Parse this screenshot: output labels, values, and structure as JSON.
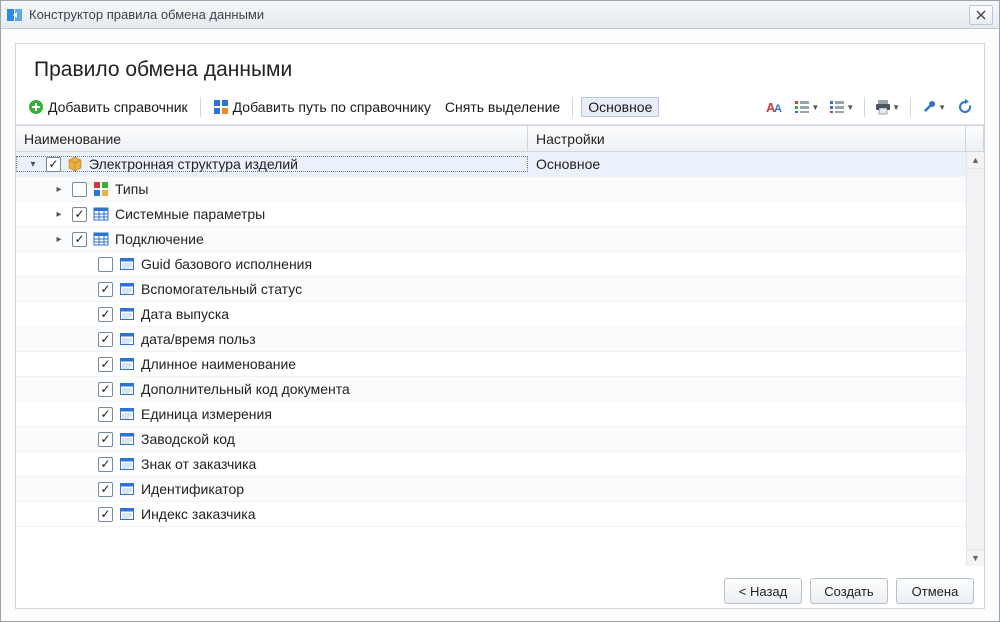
{
  "window": {
    "title": "Конструктор правила обмена данными"
  },
  "heading": "Правило обмена данными",
  "toolbar": {
    "add_reference": "Добавить справочник",
    "add_path": "Добавить путь по справочнику",
    "deselect": "Снять выделение",
    "main_toggle": "Основное"
  },
  "columns": {
    "name": "Наименование",
    "settings": "Настройки"
  },
  "tree": [
    {
      "indent": 0,
      "expander": "down",
      "checked": true,
      "icon": "package",
      "label": "Электронная структура изделий",
      "settings": "Основное",
      "selected": true,
      "focus": true
    },
    {
      "indent": 1,
      "expander": "right",
      "checked": false,
      "icon": "types",
      "label": "Типы"
    },
    {
      "indent": 1,
      "expander": "right",
      "checked": true,
      "icon": "table",
      "label": "Системные параметры"
    },
    {
      "indent": 1,
      "expander": "right",
      "checked": true,
      "icon": "table",
      "label": "Подключение"
    },
    {
      "indent": 2,
      "expander": "",
      "checked": false,
      "icon": "field",
      "label": "Guid базового исполнения"
    },
    {
      "indent": 2,
      "expander": "",
      "checked": true,
      "icon": "field",
      "label": "Вспомогательный статус"
    },
    {
      "indent": 2,
      "expander": "",
      "checked": true,
      "icon": "field",
      "label": "Дата выпуска"
    },
    {
      "indent": 2,
      "expander": "",
      "checked": true,
      "icon": "field",
      "label": "дата/время польз"
    },
    {
      "indent": 2,
      "expander": "",
      "checked": true,
      "icon": "field",
      "label": "Длинное наименование"
    },
    {
      "indent": 2,
      "expander": "",
      "checked": true,
      "icon": "field",
      "label": "Дополнительный код документа"
    },
    {
      "indent": 2,
      "expander": "",
      "checked": true,
      "icon": "field",
      "label": "Единица измерения"
    },
    {
      "indent": 2,
      "expander": "",
      "checked": true,
      "icon": "field",
      "label": "Заводской код"
    },
    {
      "indent": 2,
      "expander": "",
      "checked": true,
      "icon": "field",
      "label": "Знак от заказчика"
    },
    {
      "indent": 2,
      "expander": "",
      "checked": true,
      "icon": "field",
      "label": "Идентификатор"
    },
    {
      "indent": 2,
      "expander": "",
      "checked": true,
      "icon": "field",
      "label": "Индекс заказчика"
    }
  ],
  "footer": {
    "back": "< Назад",
    "create": "Создать",
    "cancel": "Отмена"
  }
}
